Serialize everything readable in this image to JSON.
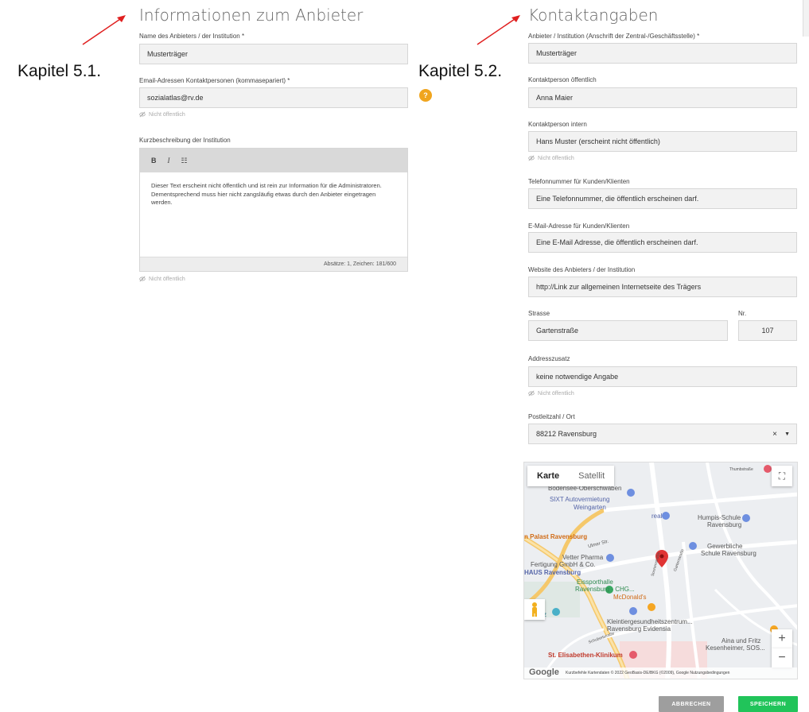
{
  "annotations": {
    "kapitel_left": "Kapitel 5.1.",
    "kapitel_right": "Kapitel 5.2."
  },
  "left": {
    "title": "Informationen zum Anbieter",
    "name_label": "Name des Anbieters / der Institution *",
    "name_value": "Musterträger",
    "email_label": "Email-Adressen Kontaktpersonen (kommasepariert) *",
    "email_value": "sozialatlas@rv.de",
    "help_badge": "?",
    "not_public_1": "Nicht öffentlich",
    "desc_label": "Kurzbeschreibung der Institution",
    "toolbar_bold": "B",
    "toolbar_italic": "I",
    "toolbar_list": "☷",
    "desc_text": "Dieser Text erscheint nicht öffentlich und ist rein zur Information für die Administratoren. Dementsprechend muss hier nicht zangsläufig etwas durch den Anbieter eingetragen werden.",
    "desc_status": "Absätze: 1, Zeichen: 181/600",
    "not_public_2": "Nicht öffentlich"
  },
  "right": {
    "title": "Kontaktangaben",
    "provider_label": "Anbieter / Institution (Anschrift der Zentral-/Geschäftsstelle) *",
    "provider_value": "Musterträger",
    "contact_public_label": "Kontaktperson öffentlich",
    "contact_public_value": "Anna Maier",
    "contact_internal_label": "Kontaktperson intern",
    "contact_internal_value": "Hans Muster (erscheint nicht öffentlich)",
    "not_public_1": "Nicht öffentlich",
    "phone_label": "Telefonnummer für Kunden/Klienten",
    "phone_value": "Eine Telefonnummer, die öffentlich erscheinen darf.",
    "email_label": "E-Mail-Adresse für Kunden/Klienten",
    "email_value": "Eine E-Mail Adresse, die öffentlich erscheinen darf.",
    "website_label": "Website des Anbieters / der Institution",
    "website_value": "http://Link zur allgemeinen Internetseite des Trägers",
    "street_label": "Strasse",
    "street_value": "Gartenstraße",
    "nr_label": "Nr.",
    "nr_value": "107",
    "addr_extra_label": "Addresszusatz",
    "addr_extra_value": "keine notwendige Angabe",
    "not_public_2": "Nicht öffentlich",
    "postal_label": "Postleitzahl / Ort",
    "postal_value": "88212 Ravensburg",
    "postal_clear": "×",
    "postal_caret": "▼"
  },
  "map": {
    "type_map": "Karte",
    "type_satellite": "Satellit",
    "labels": {
      "bodensee": "Bodensee-Oberschwaben",
      "sixt": "SIXT Autovermietung",
      "weingarten": "Weingarten",
      "real": "real",
      "humpis": "Humpis-Schule",
      "humpis2": "Ravensburg",
      "palast": "n Palast Ravensburg",
      "ulmer": "Ulmer Str.",
      "vetter": "Vetter Pharma",
      "vetter2": "Fertigung GmbH & Co.",
      "haus": "HAUS Ravensburg",
      "gewerbe": "Gewerbliche",
      "gewerbe2": "Schule Ravensburg",
      "eissport": "Eissporthalle",
      "eissport2": "Ravensburg - CHG...",
      "mcdonalds": "McDonald's",
      "halle": "enhalle",
      "parkplatz": "arkplatz",
      "klein": "Kleintiergesundheitszentrum...",
      "klein2": "Ravensburg Evidensia",
      "aina": "Aina und Fritz",
      "aina2": "Kesenheimer, SOS...",
      "elisabeth": "St. Elisabethen-Klinikum",
      "thumb": "Thumbstraße",
      "gartenstr": "Gartenstraße",
      "sonnen": "Sonnenstraße",
      "schubert": "Schubertstraße"
    },
    "google": "Google",
    "footer": "Kurzbefehle   Kartendaten © 2022 GeoBasis-DE/BKG (©2009), Google   Nutzungsbedingungen",
    "zoom_in": "+",
    "zoom_out": "−",
    "fullscreen": "⛶"
  },
  "buttons": {
    "cancel": "ABBRECHEN",
    "save": "SPEICHERN"
  },
  "colors": {
    "accent_save": "#21c45a",
    "cancel_gray": "#9e9e9e",
    "help_badge": "#f0a51e",
    "arrow_red": "#e02020",
    "marker_red": "#e03434"
  }
}
